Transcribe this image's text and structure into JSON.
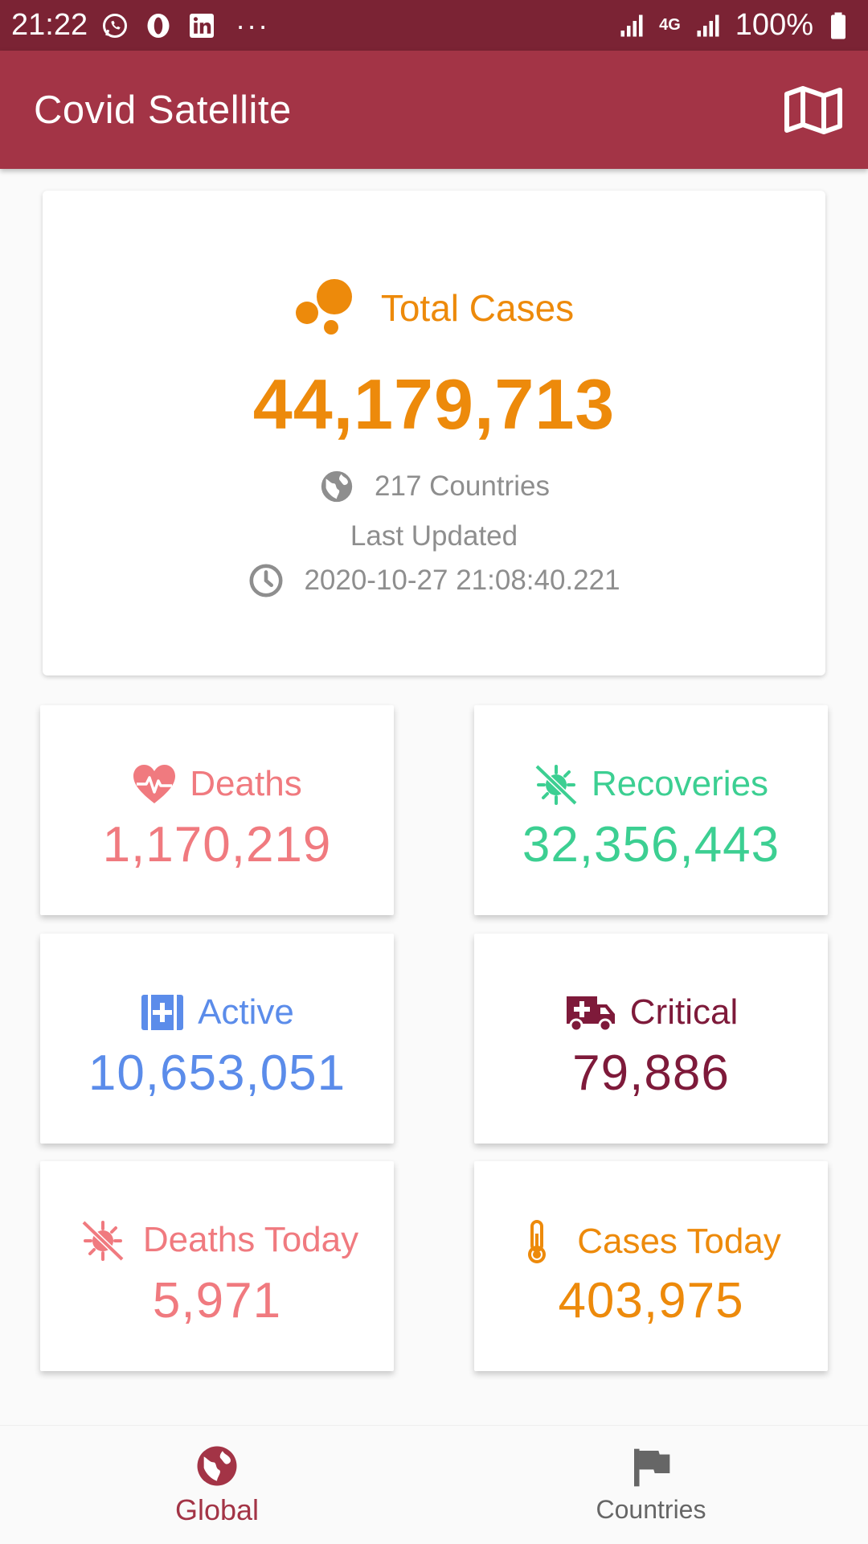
{
  "status_bar": {
    "time": "21:22",
    "icons_left": [
      "whatsapp-icon",
      "opera-icon",
      "linkedin-icon"
    ],
    "overflow": "···",
    "network": "4G",
    "battery": "100%"
  },
  "app_bar": {
    "title": "Covid Satellite",
    "action_icon": "map-icon"
  },
  "total": {
    "label": "Total Cases",
    "value": "44,179,713",
    "countries": "217 Countries",
    "last_updated_label": "Last Updated",
    "last_updated": "2020-10-27 21:08:40.221"
  },
  "stats": {
    "deaths": {
      "label": "Deaths",
      "value": "1,170,219",
      "color": "#f07a7f"
    },
    "recoveries": {
      "label": "Recoveries",
      "value": "32,356,443",
      "color": "#3ccf92"
    },
    "active": {
      "label": "Active",
      "value": "10,653,051",
      "color": "#5b8cea"
    },
    "critical": {
      "label": "Critical",
      "value": "79,886",
      "color": "#7e1a3a"
    },
    "deaths_today": {
      "label": "Deaths Today",
      "value": "5,971",
      "color": "#f07a7f"
    },
    "cases_today": {
      "label": "Cases Today",
      "value": "403,975",
      "color": "#ed8a0b"
    }
  },
  "bottom_nav": {
    "items": [
      {
        "label": "Global",
        "icon": "globe-icon",
        "active": true
      },
      {
        "label": "Countries",
        "icon": "flag-icon",
        "active": false
      }
    ]
  },
  "colors": {
    "status_bar": "#7b2334",
    "app_bar": "#a33446",
    "accent_orange": "#ed8a0b"
  }
}
